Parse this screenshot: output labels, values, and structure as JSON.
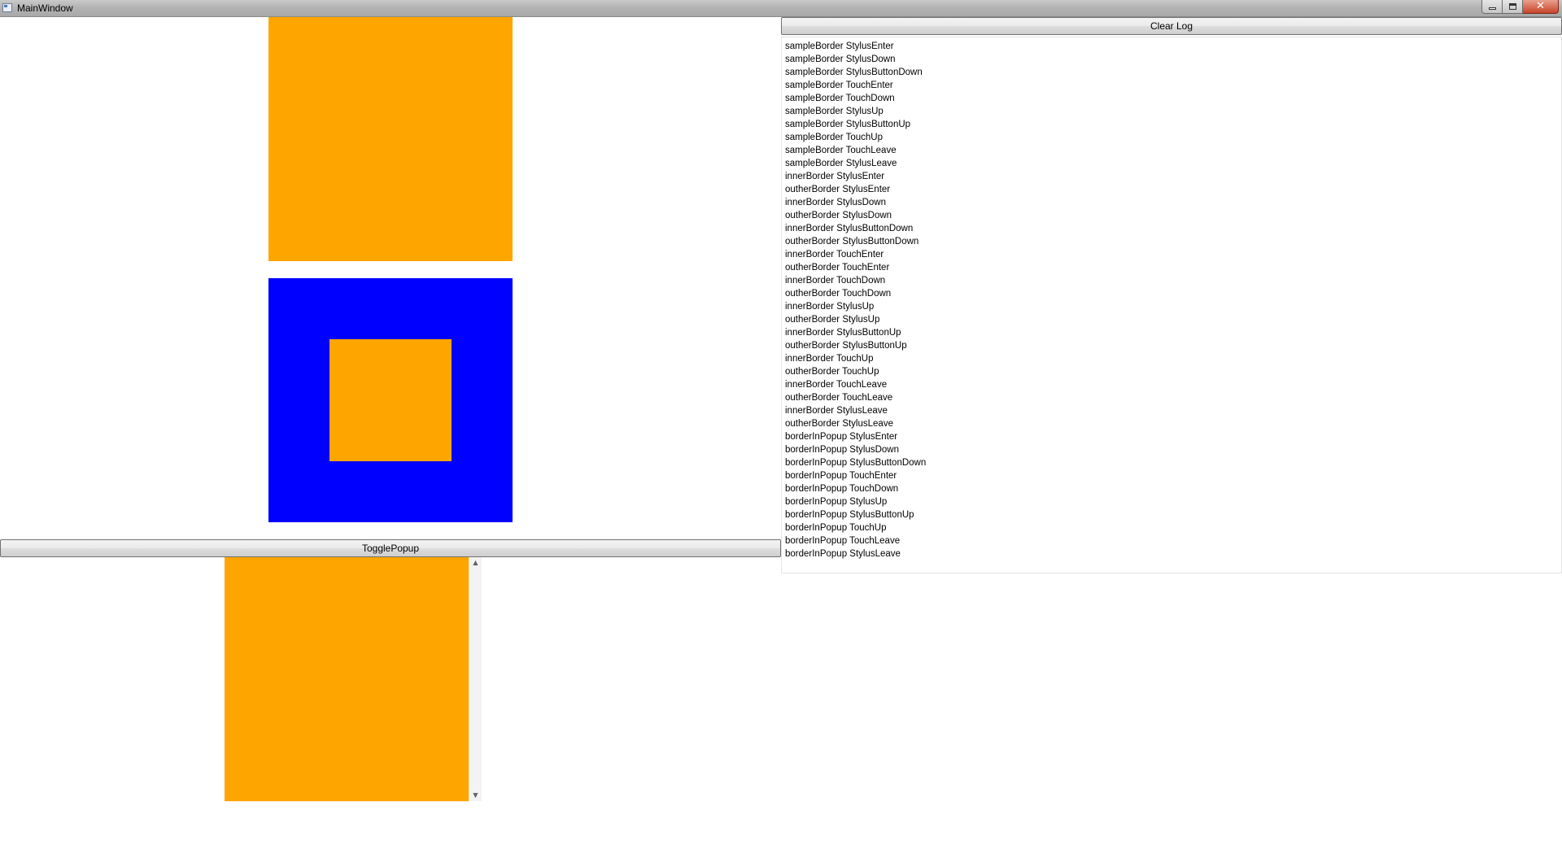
{
  "window": {
    "title": "MainWindow"
  },
  "colors": {
    "orange": "#ffa500",
    "blue": "#0000ff"
  },
  "left_pane": {
    "toggle_popup_label": "TogglePopup"
  },
  "right_pane": {
    "clear_log_label": "Clear Log",
    "log_entries": [
      "sampleBorder StylusEnter",
      "sampleBorder StylusDown",
      "sampleBorder StylusButtonDown",
      "sampleBorder TouchEnter",
      "sampleBorder TouchDown",
      "sampleBorder StylusUp",
      "sampleBorder StylusButtonUp",
      "sampleBorder TouchUp",
      "sampleBorder TouchLeave",
      "sampleBorder StylusLeave",
      "innerBorder StylusEnter",
      "outherBorder StylusEnter",
      "innerBorder StylusDown",
      "outherBorder StylusDown",
      "innerBorder StylusButtonDown",
      "outherBorder StylusButtonDown",
      "innerBorder TouchEnter",
      "outherBorder TouchEnter",
      "innerBorder TouchDown",
      "outherBorder TouchDown",
      "innerBorder StylusUp",
      "outherBorder StylusUp",
      "innerBorder StylusButtonUp",
      "outherBorder StylusButtonUp",
      "innerBorder TouchUp",
      "outherBorder TouchUp",
      "innerBorder TouchLeave",
      "outherBorder TouchLeave",
      "innerBorder StylusLeave",
      "outherBorder StylusLeave",
      "borderInPopup StylusEnter",
      "borderInPopup StylusDown",
      "borderInPopup StylusButtonDown",
      "borderInPopup TouchEnter",
      "borderInPopup TouchDown",
      "borderInPopup StylusUp",
      "borderInPopup StylusButtonUp",
      "borderInPopup TouchUp",
      "borderInPopup TouchLeave",
      "borderInPopup StylusLeave"
    ]
  },
  "icons": {
    "app": "window-app-icon",
    "minimize": "minimize-icon",
    "maximize": "restore-icon",
    "close": "close-icon",
    "scroll_up": "scroll-up-arrow-icon",
    "scroll_down": "scroll-down-arrow-icon"
  }
}
